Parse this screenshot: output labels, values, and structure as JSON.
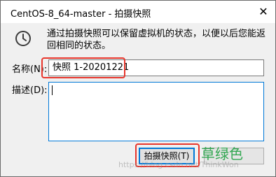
{
  "window": {
    "title": "CentOS-8_64-master - 拍摄快照",
    "close_glyph": "✕"
  },
  "dialog": {
    "info_icon": "clock-icon",
    "description": "通过拍摄快照可以保留虚拟机的状态，以便以后您能返回相同的状态。",
    "name_label": "名称(N):",
    "name_value": "快照 1-20201221",
    "desc_label": "描述(D):",
    "desc_value": ""
  },
  "buttons": {
    "take_snapshot": "拍摄快照(T)"
  },
  "annotation": {
    "text": "草绿色",
    "color": "#34a853"
  },
  "colors": {
    "highlight_box": "#e8362c",
    "focus": "#0078d7"
  },
  "watermark": "https://blog.csdn.net/ThinkWon"
}
